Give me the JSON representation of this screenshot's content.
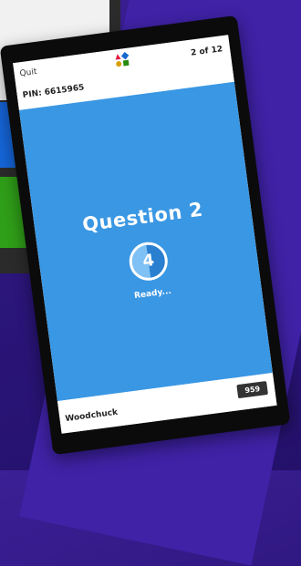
{
  "app": {
    "quit_label": "Quit",
    "progress": "2 of 12",
    "pin_label": "PIN: 6615965"
  },
  "question": {
    "title": "Question 2",
    "countdown": "4",
    "status": "Ready..."
  },
  "player": {
    "name": "Woodchuck",
    "score": "959"
  },
  "colors": {
    "question_bg": "#3a97e3",
    "logo_red": "#e21b3c",
    "logo_blue": "#1368ce",
    "logo_yellow": "#d89e00",
    "logo_green": "#26890c"
  },
  "icons": {
    "logo": "shapes-logo-icon"
  }
}
